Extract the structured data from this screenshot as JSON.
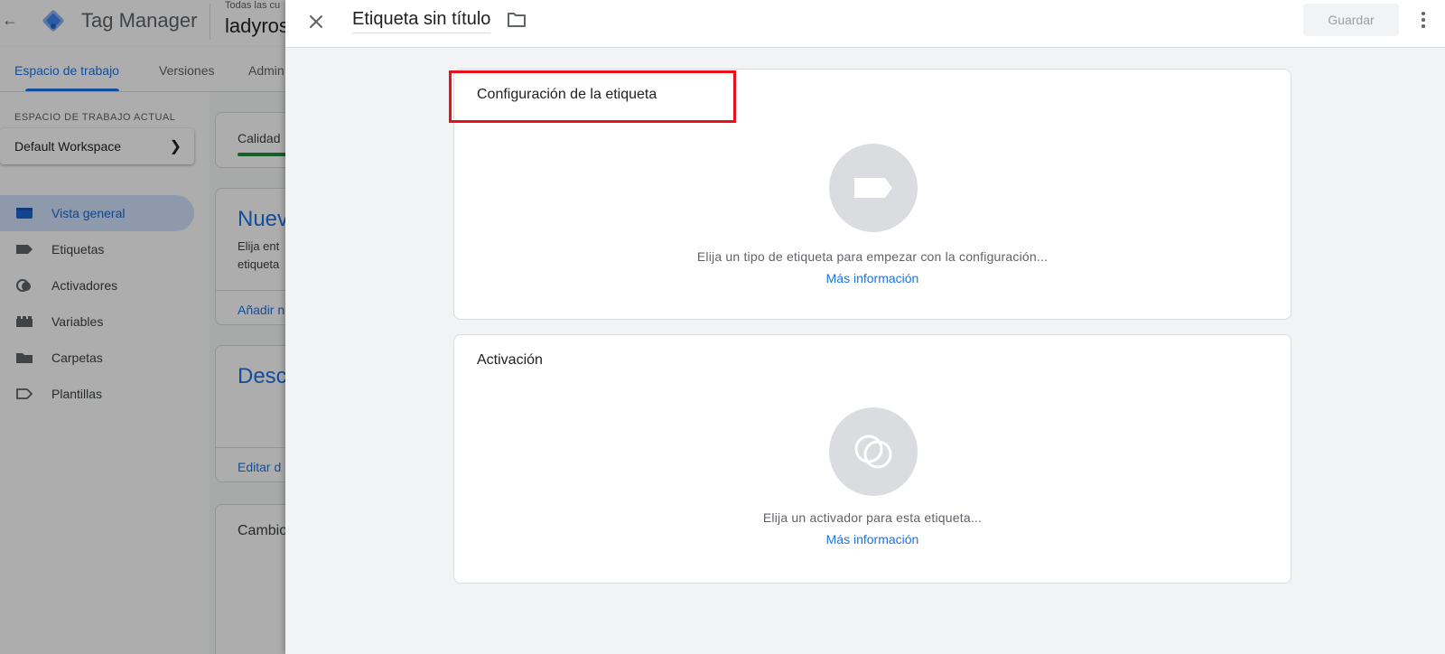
{
  "app": {
    "product_name": "Tag Manager",
    "account_caption": "Todas las cu",
    "account_name": "ladyros",
    "tabs": [
      "Espacio de trabajo",
      "Versiones",
      "Admin"
    ],
    "workspace_caption": "ESPACIO DE TRABAJO ACTUAL",
    "workspace_name": "Default Workspace",
    "nav": [
      {
        "label": "Vista general",
        "icon": "overview-icon",
        "active": true
      },
      {
        "label": "Etiquetas",
        "icon": "tag-icon"
      },
      {
        "label": "Activadores",
        "icon": "trigger-icon"
      },
      {
        "label": "Variables",
        "icon": "variables-icon"
      },
      {
        "label": "Carpetas",
        "icon": "folder-icon"
      },
      {
        "label": "Plantillas",
        "icon": "template-icon"
      }
    ],
    "cards": {
      "quality": "Calidad",
      "new_title": "Nuev",
      "new_text_1": "Elija ent",
      "new_text_2": "etiqueta",
      "new_link": "Añadir n",
      "desc_title": "Desc",
      "desc_link": "Editar d",
      "changes_title": "Cambio"
    }
  },
  "panel": {
    "title": "Etiqueta sin título",
    "save_label": "Guardar",
    "tag_config": {
      "title": "Configuración de la etiqueta",
      "hint": "Elija un tipo de etiqueta para empezar con la configuración...",
      "link": "Más información"
    },
    "triggering": {
      "title": "Activación",
      "hint": "Elija un activador para esta etiqueta...",
      "link": "Más información"
    }
  },
  "colors": {
    "accent": "#1a73e8",
    "highlight": "#e8101a",
    "scrim": "rgba(0,0,0,0.32)"
  }
}
